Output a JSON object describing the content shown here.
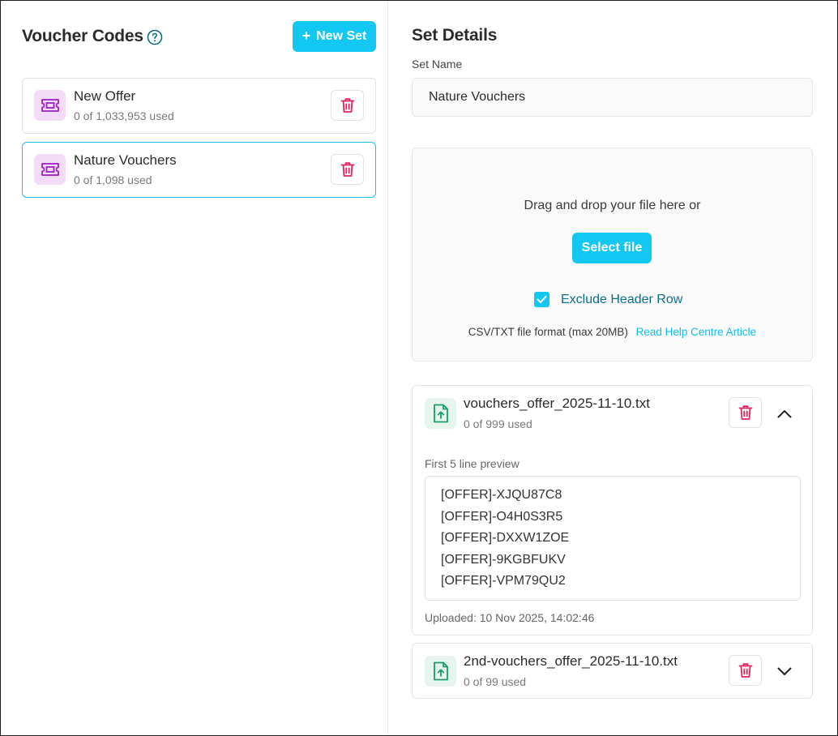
{
  "left": {
    "title": "Voucher Codes",
    "new_set_label": "New Set",
    "sets": [
      {
        "name": "New Offer",
        "used": "0 of 1,033,953 used"
      },
      {
        "name": "Nature Vouchers",
        "used": "0 of 1,098 used"
      }
    ]
  },
  "right": {
    "title": "Set Details",
    "set_name_label": "Set Name",
    "set_name_value": "Nature Vouchers",
    "dropzone": {
      "text": "Drag and drop your file here or",
      "select_label": "Select file",
      "checkbox_label": "Exclude Header Row",
      "checkbox_checked": true,
      "format_text": "CSV/TXT file format (max 20MB)",
      "help_link": "Read Help Centre Article"
    },
    "files": [
      {
        "name": "vouchers_offer_2025-11-10.txt",
        "used": "0 of 999 used",
        "expanded": true,
        "preview_label": "First 5 line preview",
        "preview_lines": [
          "[OFFER]-XJQU87C8",
          "[OFFER]-O4H0S3R5",
          "[OFFER]-DXXW1ZOE",
          "[OFFER]-9KGBFUKV",
          "[OFFER]-VPM79QU2"
        ],
        "uploaded": "Uploaded: 10 Nov 2025, 14:02:46"
      },
      {
        "name": "2nd-vouchers_offer_2025-11-10.txt",
        "used": "0 of 99 used",
        "expanded": false
      }
    ]
  },
  "colors": {
    "accent": "#12c7f2",
    "danger": "#e0245e",
    "set_icon": "#9b1fc4",
    "file_icon": "#1a9d6a"
  },
  "icons": {
    "help": "help-circle-icon",
    "set": "ticket-icon",
    "delete": "trash-icon",
    "file": "file-upload-icon",
    "collapse": "chevron-up-icon",
    "expand": "chevron-down-icon",
    "checkbox": "check-icon"
  }
}
